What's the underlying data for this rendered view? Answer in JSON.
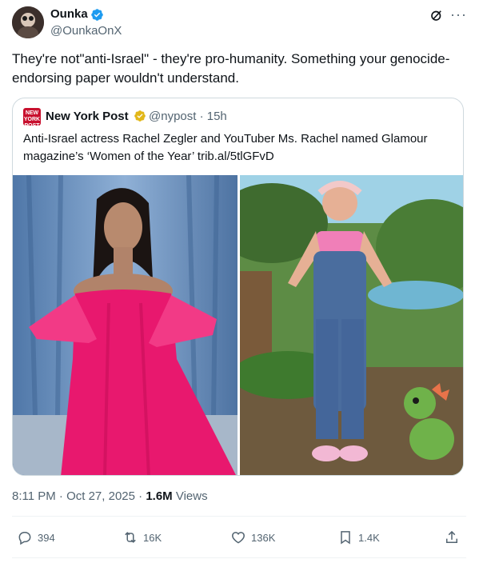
{
  "author": {
    "name": "Ounka",
    "handle": "@OunkaOnX"
  },
  "tweet": {
    "text": "They're not\"anti-Israel\" - they're pro-humanity. Something your genocide-endorsing paper wouldn't understand."
  },
  "quoted": {
    "logo_text": "NEW YORK POST",
    "name": "New York Post",
    "handle_time": "@nypost · 15h",
    "text": "Anti-Israel actress Rachel Zegler and YouTuber Ms. Rachel named Glamour magazine’s ‘Women of the Year’ trib.al/5tlGFvD"
  },
  "meta": {
    "time": "8:11 PM · Oct 27, 2025 · ",
    "views": "1.6M",
    "views_label": " Views"
  },
  "actions": {
    "replies": "394",
    "reposts": "16K",
    "likes": "136K",
    "bookmarks": "1.4K"
  },
  "colors": {
    "verified_blue": "#1d9bf0",
    "verified_gold": "#e2b719",
    "nypost_red": "#c8102e"
  },
  "icons": [
    "verified-badge-icon",
    "grok-icon",
    "more-icon",
    "reply-icon",
    "repost-icon",
    "like-icon",
    "bookmark-icon",
    "share-icon"
  ]
}
